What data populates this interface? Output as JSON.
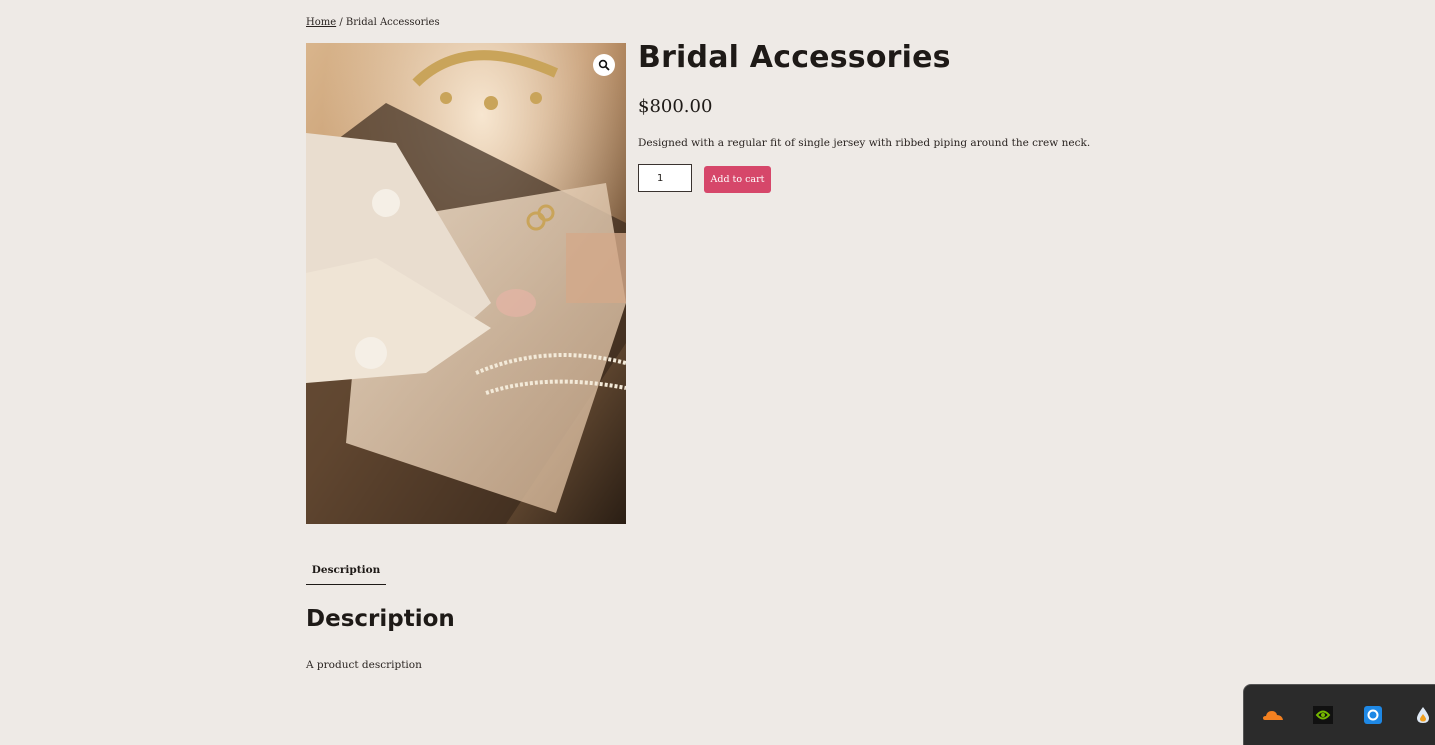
{
  "breadcrumb": {
    "home_label": "Home",
    "separator": " / ",
    "current": "Bridal Accessories"
  },
  "product": {
    "title": "Bridal Accessories",
    "price": "$800.00",
    "short_description": "Designed with a regular fit of single jersey with ribbed piping around the crew neck.",
    "quantity": "1",
    "add_to_cart_label": "Add to cart",
    "image_icon": "magnifier-zoom-icon"
  },
  "tabs": [
    {
      "label": "Description"
    }
  ],
  "description": {
    "heading": "Description",
    "text": "A product description"
  },
  "tray": {
    "icons": [
      "cloudflare-icon",
      "nvidia-icon",
      "screen-capture-icon",
      "droplet-icon"
    ]
  },
  "colors": {
    "background": "#eeeae6",
    "accent": "#d6476a",
    "text": "#1e1a17"
  }
}
